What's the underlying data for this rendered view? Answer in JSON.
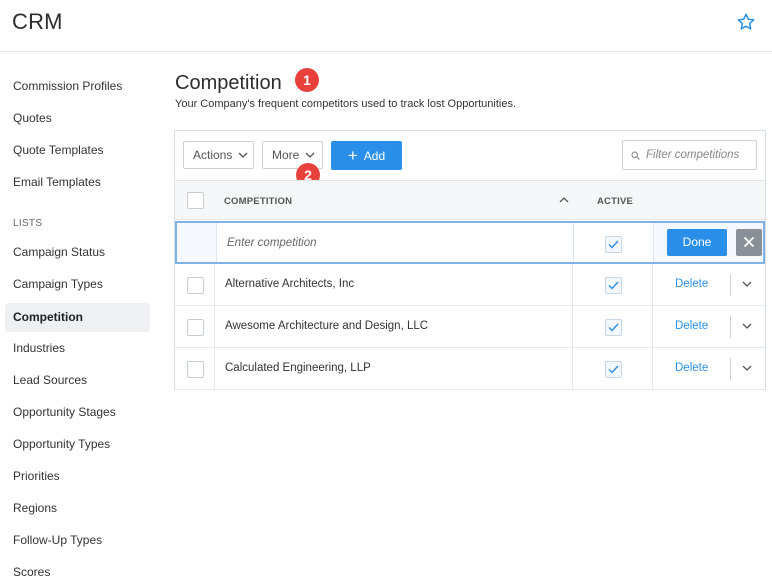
{
  "app": {
    "title": "CRM"
  },
  "sidebar": {
    "items_top": [
      {
        "label": "Commission Profiles"
      },
      {
        "label": "Quotes"
      },
      {
        "label": "Quote Templates"
      },
      {
        "label": "Email Templates"
      }
    ],
    "lists_heading": "LISTS",
    "items_lists": [
      {
        "label": "Campaign Status"
      },
      {
        "label": "Campaign Types"
      },
      {
        "label": "Competition",
        "active": true
      },
      {
        "label": "Industries"
      },
      {
        "label": "Lead Sources"
      },
      {
        "label": "Opportunity Stages"
      },
      {
        "label": "Opportunity Types"
      },
      {
        "label": "Priorities"
      },
      {
        "label": "Regions"
      },
      {
        "label": "Follow-Up Types"
      },
      {
        "label": "Scores"
      }
    ]
  },
  "page": {
    "title": "Competition",
    "subtitle": "Your Company's frequent competitors used to track lost Opportunities."
  },
  "badges": [
    "1",
    "2"
  ],
  "toolbar": {
    "actions_label": "Actions",
    "more_label": "More",
    "add_label": "Add",
    "filter_placeholder": "Filter competitions"
  },
  "table": {
    "columns": {
      "name": "COMPETITION",
      "active": "ACTIVE"
    },
    "new_row": {
      "placeholder": "Enter competition",
      "active": true,
      "done_label": "Done"
    },
    "rows": [
      {
        "name": "Alternative Architects, Inc",
        "active": true,
        "action": "Delete"
      },
      {
        "name": "Awesome Architecture and Design, LLC",
        "active": true,
        "action": "Delete"
      },
      {
        "name": "Calculated Engineering, LLP",
        "active": true,
        "action": "Delete"
      }
    ]
  },
  "colors": {
    "accent": "#2a8fe8",
    "badge": "#e8413c",
    "active_bg": "#eef0f3"
  }
}
